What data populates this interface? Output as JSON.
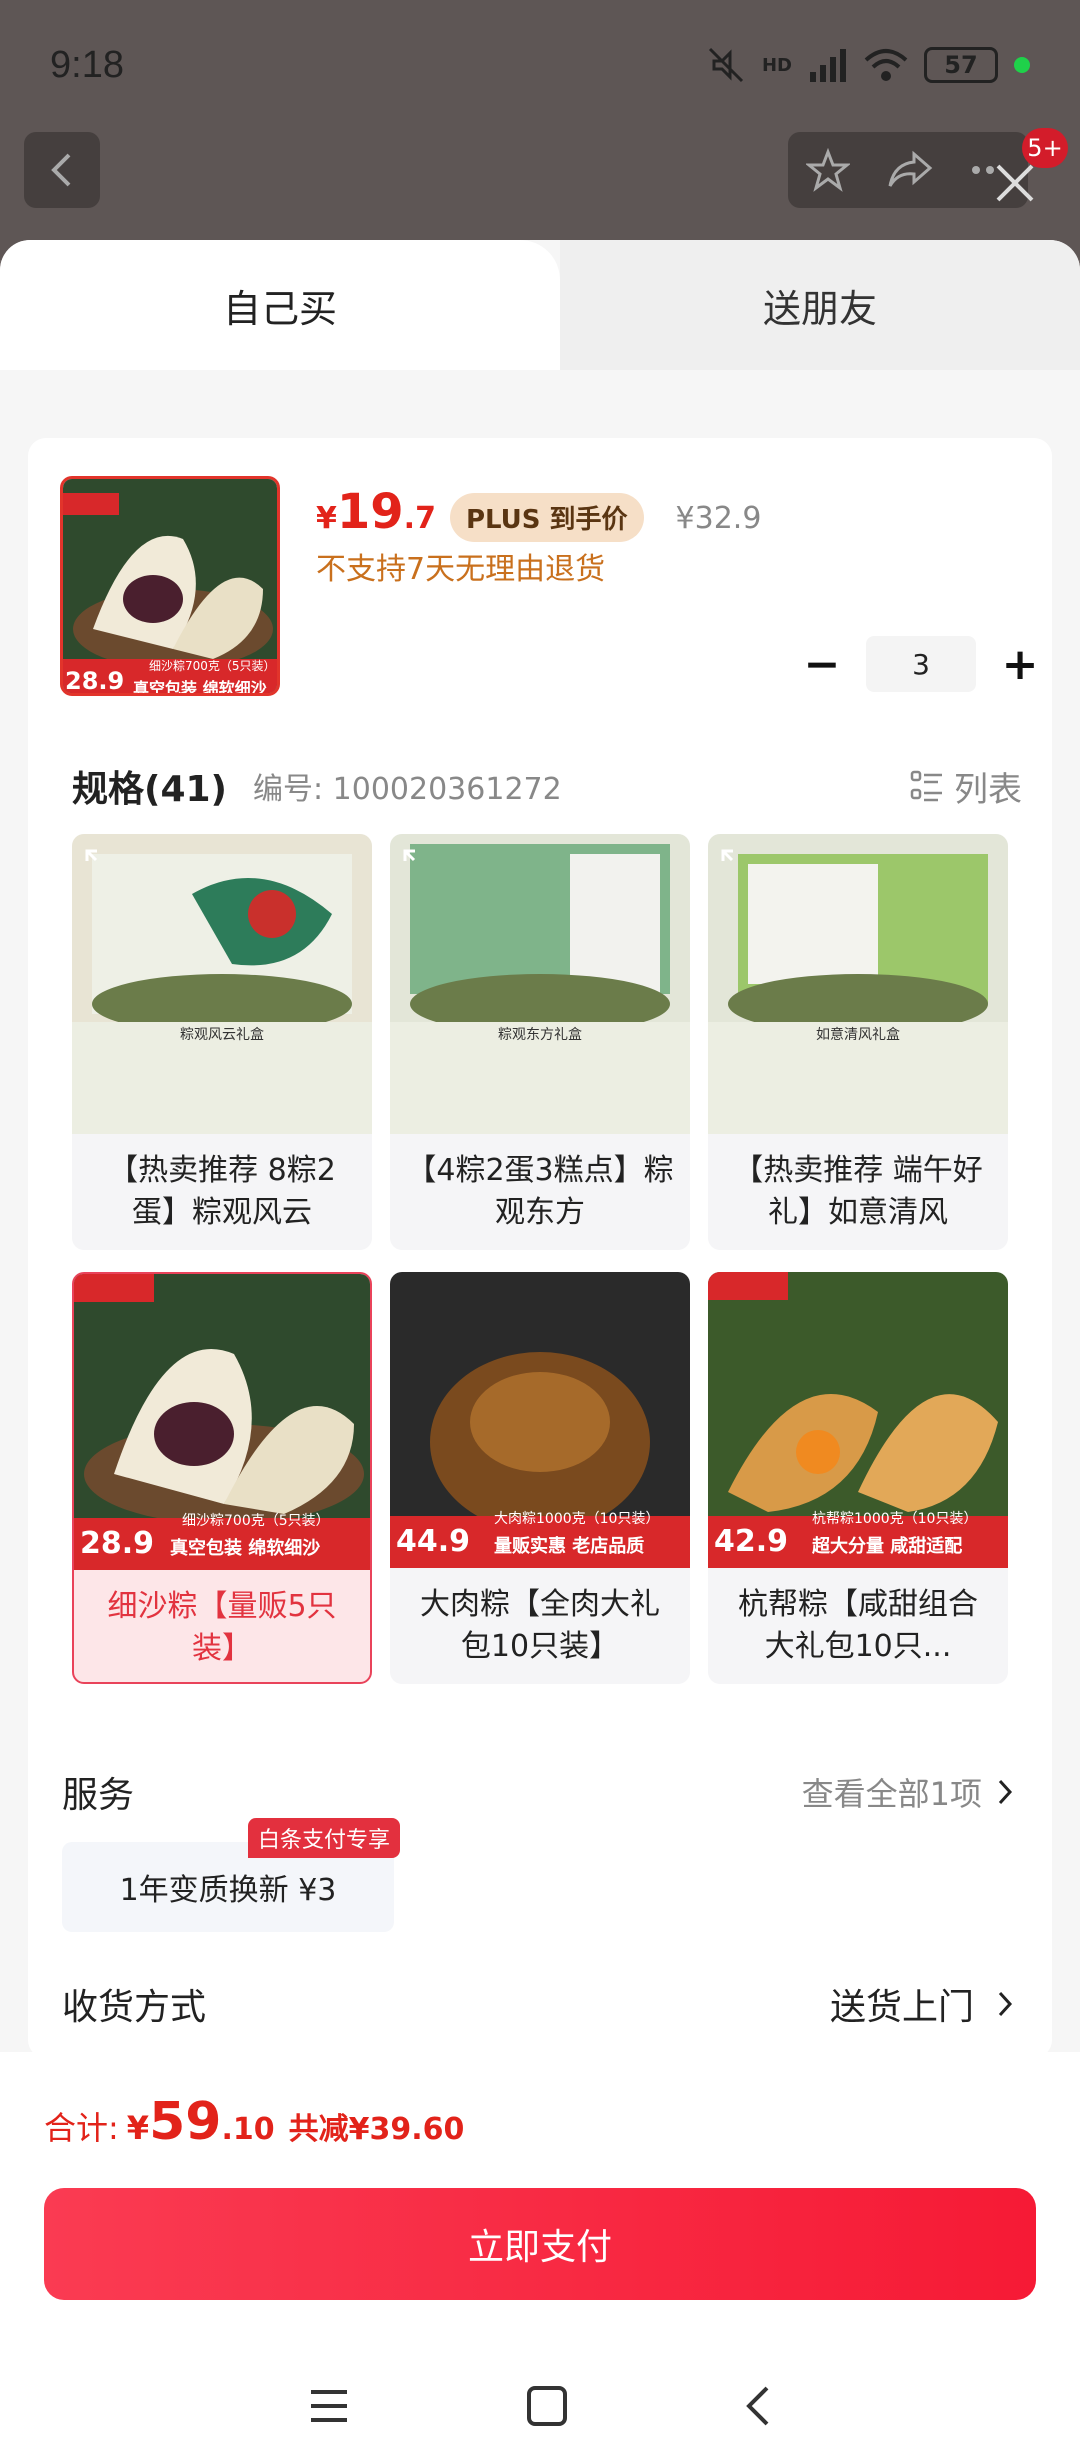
{
  "status_bar": {
    "time": "9:18",
    "battery": "57",
    "network": "HD"
  },
  "top_bar": {
    "badge": "5+"
  },
  "tabs": [
    {
      "label": "自己买"
    },
    {
      "label": "送朋友"
    }
  ],
  "product": {
    "thumb_price": "28.9",
    "thumb_caption1": "细沙粽700克（5只装）",
    "thumb_caption2": "真空包装 绵软细沙",
    "price_currency": "¥",
    "price_int": "19",
    "price_dec": ".7",
    "plus_label": "PLUS 到手价",
    "original_price": "¥32.9",
    "return_note": "不支持7天无理由退货",
    "quantity": "3"
  },
  "specs": {
    "title": "规格(41)",
    "code": "编号: 100020361272",
    "list_label": "列表",
    "items": [
      {
        "title": "【热卖推荐 8粽2蛋】粽观风云",
        "box": "粽观风云礼盒",
        "selected": false
      },
      {
        "title": "【4粽2蛋3糕点】粽观东方",
        "box": "粽观东方礼盒",
        "selected": false
      },
      {
        "title": "【热卖推荐 端午好礼】如意清风",
        "box": "如意清风礼盒",
        "selected": false
      },
      {
        "title": "细沙粽【量贩5只装】",
        "price": "28.9",
        "caption": "细沙粽700克（5只装）",
        "caption2": "真空包装 绵软细沙",
        "selected": true
      },
      {
        "title": "大肉粽【全肉大礼包10只装】",
        "price": "44.9",
        "caption": "大肉粽1000克（10只装）",
        "caption2": "量贩实惠 老店品质",
        "selected": false
      },
      {
        "title": "杭帮粽【咸甜组合大礼包10只...",
        "price": "42.9",
        "caption": "杭帮粽1000克（10只装）",
        "caption2": "超大分量 咸甜适配",
        "selected": false
      }
    ]
  },
  "service": {
    "title": "服务",
    "more": "查看全部1项",
    "chip": "1年变质换新 ¥3",
    "chip_tag": "白条支付专享"
  },
  "shipping": {
    "title": "收货方式",
    "value": "送货上门"
  },
  "footer": {
    "total_label": "合计:",
    "total_currency": "¥",
    "total_int": "59",
    "total_dec": ".10",
    "discount": "共减¥39.60",
    "pay_label": "立即支付"
  },
  "colors": {
    "accent": "#e2231a",
    "pay_gradient_start": "#fa3b52",
    "pay_gradient_end": "#f61a35"
  }
}
